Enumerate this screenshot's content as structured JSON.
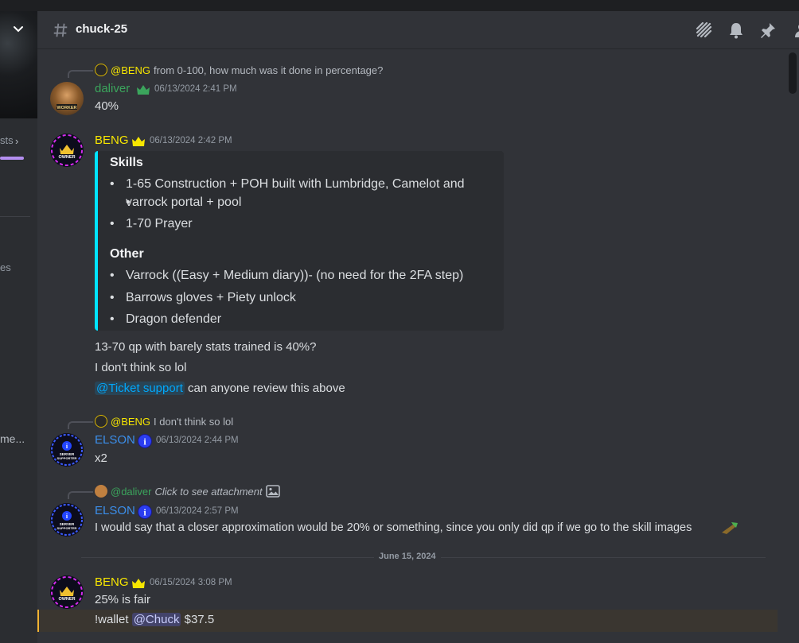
{
  "sidebar": {
    "snippet_1": "sts",
    "snippet_2": "es",
    "snippet_3": "me...",
    "accent_color": "#b48ef0"
  },
  "header": {
    "channel_name": "chuck-25",
    "icons": [
      "threads-icon",
      "bell-icon",
      "pin-icon",
      "members-icon"
    ]
  },
  "messages": [
    {
      "reply": {
        "mention": "@BENG",
        "text": "from 0-100, how much was it done in percentage?"
      },
      "author": "daliver",
      "author_color": "#3ba55c",
      "timestamp": "06/13/2024 2:41 PM",
      "lines": [
        "40%"
      ]
    },
    {
      "author": "BENG",
      "author_color": "#f7e600",
      "timestamp": "06/13/2024 2:42 PM",
      "embed": {
        "sections": [
          {
            "heading": "Skills",
            "items": [
              "1-65 Construction + POH built with Lumbridge, Camelot and",
              "varrock portal + pool",
              "1-70 Prayer"
            ]
          },
          {
            "heading": "Other",
            "items": [
              "Varrock ((Easy + Medium diary))- (no need for the 2FA step)",
              "Barrows gloves + Piety unlock",
              "Dragon defender"
            ]
          }
        ]
      },
      "lines": [
        "13-70 qp with barely stats trained is 40%?",
        "I don't think so lol"
      ],
      "mention_line": {
        "mention": "@Ticket support",
        "text": "can anyone review this above"
      }
    },
    {
      "reply": {
        "mention": "@BENG",
        "text": "I don't think so lol"
      },
      "author": "ELSON",
      "author_color": "#3b8eea",
      "timestamp": "06/13/2024 2:44 PM",
      "lines": [
        "x2"
      ]
    },
    {
      "reply": {
        "mention": "@daliver",
        "text": "Click to see attachment"
      },
      "author": "ELSON",
      "author_color": "#3b8eea",
      "timestamp": "06/13/2024 2:57 PM",
      "lines": [
        "I would say that a closer approximation would be 20% or something, since you only did qp if we go to the skill images"
      ]
    }
  ],
  "date_divider": "June 15, 2024",
  "last_message": {
    "author": "BENG",
    "author_color": "#f7e600",
    "timestamp": "06/15/2024 3:08 PM",
    "line1": "25% is fair",
    "cmd": "!wallet",
    "mention": "@Chuck",
    "amount": "$37.5"
  },
  "avatar_labels": {
    "owner": "OWNER",
    "supporter_line1": "SERVER",
    "supporter_line2": "SUPPORTER",
    "worker": "WORKER"
  }
}
